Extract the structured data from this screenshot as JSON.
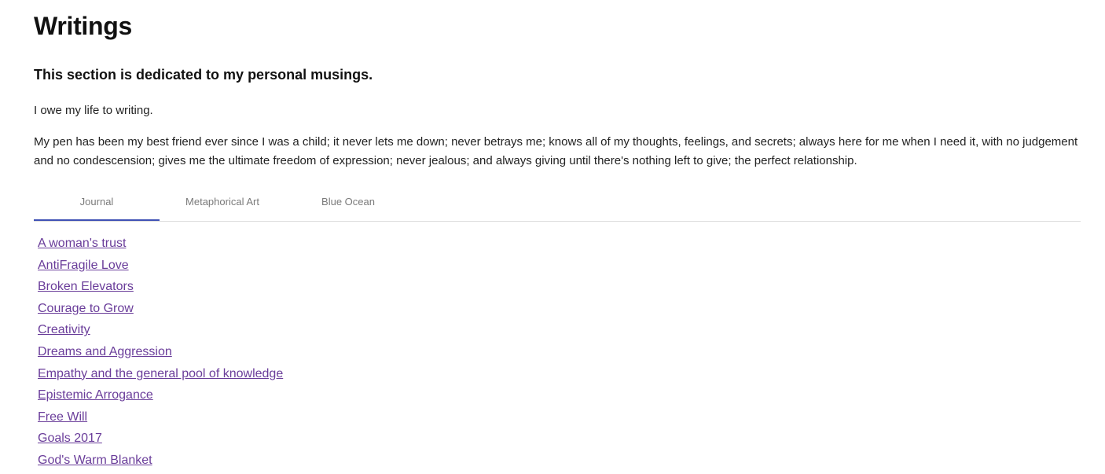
{
  "page": {
    "title": "Writings",
    "subtitle": "This section is dedicated to my personal musings.",
    "intro": "I owe my life to writing.",
    "body": "My pen has been my best friend ever since I was a child; it never lets me down; never betrays me; knows all of my thoughts, feelings, and secrets; always here for me when I need it, with no judgement and no condescension; gives me the ultimate freedom of expression; never jealous; and always giving until there's nothing left to give; the perfect relationship."
  },
  "tabs": [
    {
      "label": "Journal",
      "active": true
    },
    {
      "label": "Metaphorical Art",
      "active": false
    },
    {
      "label": "Blue Ocean",
      "active": false
    }
  ],
  "journal": {
    "links": [
      "A woman's trust",
      "AntiFragile Love",
      "Broken Elevators",
      "Courage to Grow",
      "Creativity",
      "Dreams and Aggression",
      "Empathy and the general pool of knowledge",
      "Epistemic Arrogance",
      "Free Will",
      "Goals 2017",
      "God's Warm Blanket"
    ]
  },
  "colors": {
    "link": "#6a3d9a",
    "tab_indicator": "#3f51b5",
    "tab_text": "#7a7a7a"
  }
}
